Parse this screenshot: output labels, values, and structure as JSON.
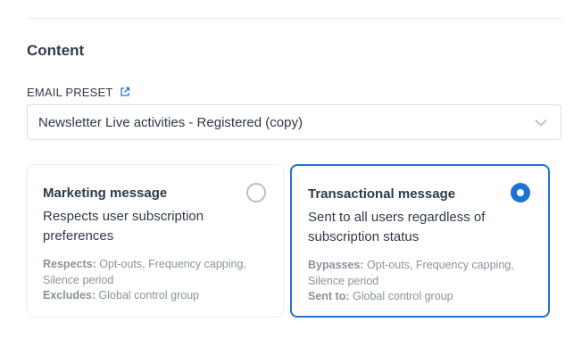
{
  "section": {
    "title": "Content"
  },
  "email_preset": {
    "label": "EMAIL PRESET",
    "link_icon": "external-link-icon",
    "value": "Newsletter Live activities - Registered (copy)",
    "dropdown_icon": "chevron-down-icon"
  },
  "message_types": {
    "marketing": {
      "title": "Marketing message",
      "description": "Respects user subscription preferences",
      "meta1_label": "Respects:",
      "meta1_value": " Opt-outs, Frequency capping, Silence period",
      "meta2_label": "Excludes:",
      "meta2_value": " Global control group",
      "selected": false
    },
    "transactional": {
      "title": "Transactional message",
      "description": "Sent to all users regardless of subscription status",
      "meta1_label": "Bypasses:",
      "meta1_value": " Opt-outs, Frequency capping, Silence period",
      "meta2_label": "Sent to:",
      "meta2_value": " Global control group",
      "selected": true
    }
  },
  "colors": {
    "accent": "#1e73d2",
    "text": "#2f3a48",
    "muted": "#8a929c",
    "border": "#d9dde3"
  }
}
